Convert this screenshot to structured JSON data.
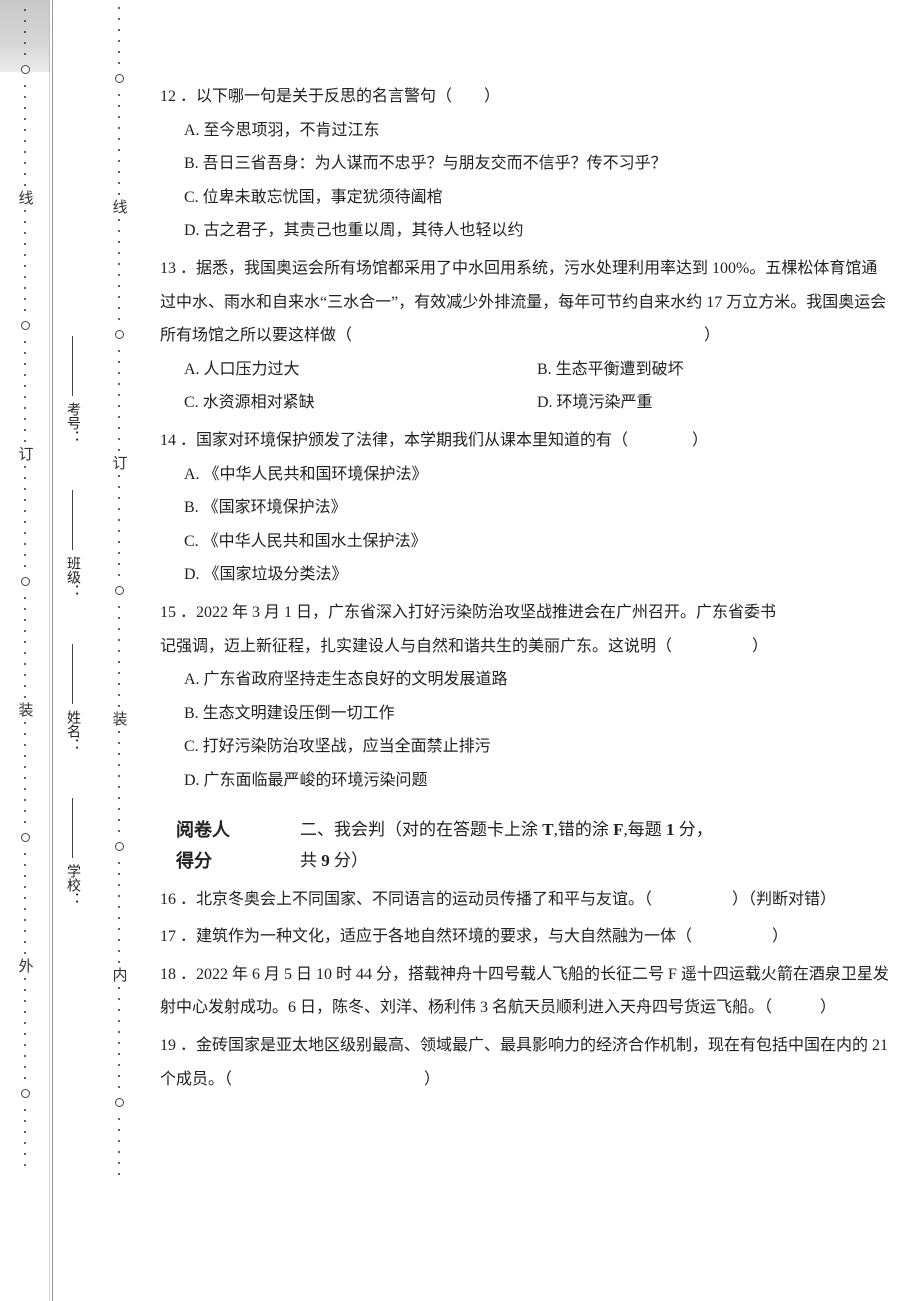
{
  "outerColumn": {
    "markers": [
      "线",
      "订",
      "装",
      "外"
    ]
  },
  "innerColumn": {
    "formFields": [
      {
        "label": "考号："
      },
      {
        "label": "班级："
      },
      {
        "label": "姓名："
      },
      {
        "label": "学校："
      }
    ]
  },
  "gutterColumn": {
    "markers": [
      "线",
      "订",
      "装",
      "内"
    ]
  },
  "questions": {
    "q12": {
      "text": "12 ．以下哪一句是关于反思的名言警句（　　）",
      "A": "A. 至今思项羽，不肯过江东",
      "B": "B. 吾日三省吾身：为人谋而不忠乎？与朋友交而不信乎？传不习乎？",
      "C": "C. 位卑未敢忘忧国，事定犹须待阖棺",
      "D": "D. 古之君子，其责己也重以周，其待人也轻以约"
    },
    "q13": {
      "text": "13 ．据悉，我国奥运会所有场馆都采用了中水回用系统，污水处理利用率达到 100%。五棵松体育馆通过中水、雨水和自来水“三水合一”，有效减少外排流量，每年可节约自来水约 17 万立方米。我国奥运会所有场馆之所以要这样做（　　　　　　　　　　　　　　　　　　　　　　）",
      "A": "A. 人口压力过大",
      "B": "B. 生态平衡遭到破坏",
      "C": "C. 水资源相对紧缺",
      "D": "D. 环境污染严重"
    },
    "q14": {
      "text": "14 ．国家对环境保护颁发了法律，本学期我们从课本里知道的有（　　　　）",
      "A": "A. 《中华人民共和国环境保护法》",
      "B": "B. 《国家环境保护法》",
      "C": "C. 《中华人民共和国水土保护法》",
      "D": "D. 《国家垃圾分类法》"
    },
    "q15": {
      "part1": "15 ．2022 年 3 月 1 日，广东省深入打好污染防治攻坚战推进会在广州召开。广东省委书",
      "part2": "记强调，迈上新征程，扎实建设人与自然和谐共生的美丽广东。这说明（　　　　　）",
      "A": "A. 广东省政府坚持走生态良好的文明发展道路",
      "B": "B. 生态文明建设压倒一切工作",
      "C": "C. 打好污染防治攻坚战，应当全面禁止排污",
      "D": "D. 广东面临最严峻的环境污染问题"
    }
  },
  "section2": {
    "leftLine1": "阅卷人",
    "leftLine2": "得分",
    "titlePrefix": "二、我会判（对的在答题卡上涂 ",
    "tLetter": "T",
    "mid": ",错的涂 ",
    "fLetter": "F",
    "mid2": ",每题 ",
    "points": "1",
    "pointsUnit": " 分，",
    "line2a": "共 ",
    "total": "9",
    "line2b": " 分）"
  },
  "judges": {
    "q16": "16 ．北京冬奥会上不同国家、不同语言的运动员传播了和平与友谊。（　　　　　）（判断对错）",
    "q17": "17 ．建筑作为一种文化，适应于各地自然环境的要求，与大自然融为一体（　　　　　）",
    "q18": "18 ．2022 年 6 月 5 日 10 时 44 分，搭载神舟十四号载人飞船的长征二号 F 遥十四运载火箭在酒泉卫星发射中心发射成功。6 日，陈冬、刘洋、杨利伟 3 名航天员顺利进入天舟四号货运飞船。（　　　）",
    "q19": "19 ．金砖国家是亚太地区级别最高、领域最广、最具影响力的经济合作机制，现在有包括中国在内的 21 个成员。（　　　　　　　　　　　　）"
  }
}
